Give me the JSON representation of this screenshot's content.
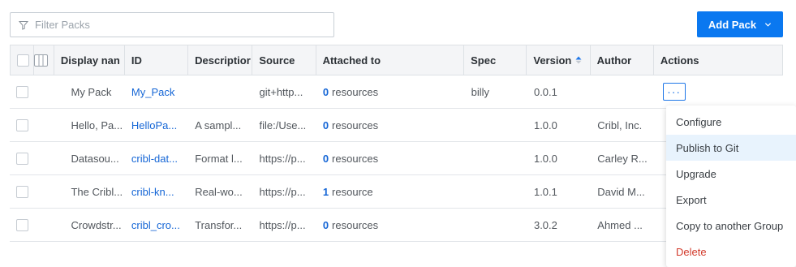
{
  "filter": {
    "placeholder": "Filter Packs",
    "icon": "filter-icon"
  },
  "add_pack": {
    "label": "Add Pack"
  },
  "table": {
    "headers": {
      "display_name": "Display nan",
      "id": "ID",
      "description": "Descriptior",
      "source": "Source",
      "attached_to": "Attached to",
      "spec": "Spec",
      "version": "Version",
      "author": "Author",
      "actions": "Actions"
    },
    "rows": [
      {
        "name": "My Pack",
        "id": "My_Pack",
        "description": "",
        "source": "git+http...",
        "attached_count": "0",
        "attached_label": "resources",
        "spec": "billy",
        "version": "0.0.1",
        "author": ""
      },
      {
        "name": "Hello, Pa...",
        "id": "HelloPa...",
        "description": "A sampl...",
        "source": "file:/Use...",
        "attached_count": "0",
        "attached_label": "resources",
        "spec": "",
        "version": "1.0.0",
        "author": "Cribl, Inc."
      },
      {
        "name": "Datasou...",
        "id": "cribl-dat...",
        "description": "Format l...",
        "source": "https://p...",
        "attached_count": "0",
        "attached_label": "resources",
        "spec": "",
        "version": "1.0.0",
        "author": "Carley R..."
      },
      {
        "name": "The Cribl...",
        "id": "cribl-kn...",
        "description": "Real-wo...",
        "source": "https://p...",
        "attached_count": "1",
        "attached_label": "resource",
        "spec": "",
        "version": "1.0.1",
        "author": "David M..."
      },
      {
        "name": "Crowdstr...",
        "id": "cribl_cro...",
        "description": "Transfor...",
        "source": "https://p...",
        "attached_count": "0",
        "attached_label": "resources",
        "spec": "",
        "version": "3.0.2",
        "author": "Ahmed ..."
      }
    ]
  },
  "actions_button": {
    "label": "···"
  },
  "menu": {
    "items": [
      {
        "label": "Configure"
      },
      {
        "label": "Publish to Git"
      },
      {
        "label": "Upgrade"
      },
      {
        "label": "Export"
      },
      {
        "label": "Copy to another Group"
      },
      {
        "label": "Delete"
      }
    ]
  },
  "colors": {
    "accent": "#0a78f0",
    "link": "#1566d6",
    "danger": "#d23a2b",
    "header_bg": "#f4f5f7"
  }
}
